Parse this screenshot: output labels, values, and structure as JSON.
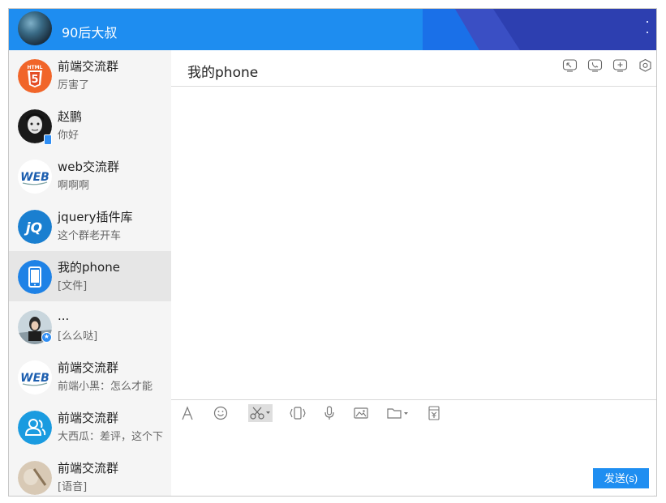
{
  "header": {
    "username": "90后大叔"
  },
  "chat": {
    "title": "我的phone",
    "send_label": "发送(s)"
  },
  "conversations": [
    {
      "name": "前端交流群",
      "preview": "厉害了",
      "icon": "html5-icon"
    },
    {
      "name": "赵鹏",
      "preview": "你好",
      "icon": "user-avatar"
    },
    {
      "name": "web交流群",
      "preview": "啊啊啊",
      "icon": "web-logo-icon"
    },
    {
      "name": "jquery插件库",
      "preview": "这个群老开车",
      "icon": "jquery-icon"
    },
    {
      "name": "我的phone",
      "preview": "[文件]",
      "icon": "phone-icon",
      "active": true
    },
    {
      "name": "...",
      "preview": "[么么哒]",
      "icon": "user-avatar"
    },
    {
      "name": "前端交流群",
      "preview": "前端小黑：怎么才能",
      "icon": "web-logo-icon"
    },
    {
      "name": "前端交流群",
      "preview": "大西瓜：差评，这个下",
      "icon": "group-icon"
    },
    {
      "name": "前端交流群",
      "preview": "[语音]",
      "icon": "user-avatar"
    }
  ],
  "toolbar_icons": [
    "font-icon",
    "emoji-icon",
    "screenshot-icon",
    "shake-icon",
    "voice-icon",
    "image-icon",
    "folder-icon",
    "red-packet-icon"
  ],
  "header_icons": [
    "remote-assist-icon",
    "phone-call-icon",
    "add-icon",
    "settings-icon"
  ],
  "colors": {
    "accent": "#1f8ef1",
    "titlebar": "#1e8df0",
    "active_item": "#e6e6e6"
  }
}
